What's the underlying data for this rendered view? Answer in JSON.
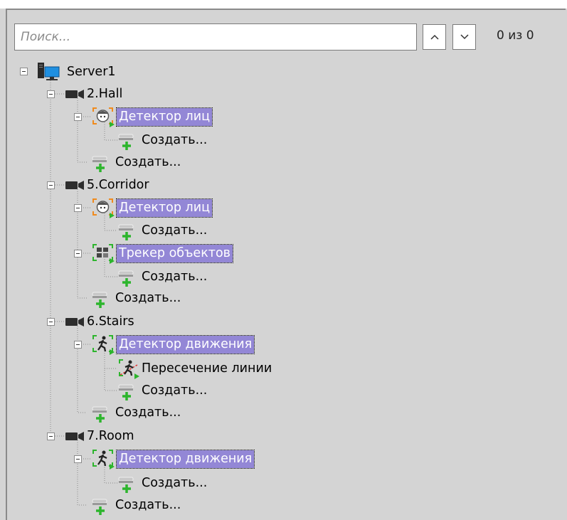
{
  "search": {
    "placeholder": "Поиск...",
    "value": ""
  },
  "nav": {
    "up_glyph": "^",
    "down_glyph": "⌄",
    "counter": "0 из 0"
  },
  "tree": {
    "server": {
      "label": "Server1",
      "icon": "server-icon"
    },
    "cameras": [
      {
        "label": "2.Hall",
        "detectors": [
          {
            "label": "Детектор лиц",
            "icon": "face-detector-icon",
            "selected": true,
            "children": [
              {
                "label": "Создать...",
                "icon": "create-icon"
              }
            ]
          }
        ],
        "create": "Создать..."
      },
      {
        "label": "5.Corridor",
        "detectors": [
          {
            "label": "Детектор лиц",
            "icon": "face-detector-icon",
            "selected": true,
            "children": [
              {
                "label": "Создать...",
                "icon": "create-icon"
              }
            ]
          },
          {
            "label": "Трекер объектов",
            "icon": "object-tracker-icon",
            "selected": true,
            "children": [
              {
                "label": "Создать...",
                "icon": "create-icon"
              }
            ]
          }
        ],
        "create": "Создать..."
      },
      {
        "label": "6.Stairs",
        "detectors": [
          {
            "label": "Детектор движения",
            "icon": "motion-detector-icon",
            "selected": true,
            "children": [
              {
                "label": "Пересечение линии",
                "icon": "line-crossing-icon"
              },
              {
                "label": "Создать...",
                "icon": "create-icon"
              }
            ]
          }
        ],
        "create": "Создать..."
      },
      {
        "label": "7.Room",
        "detectors": [
          {
            "label": "Детектор движения",
            "icon": "motion-detector-icon",
            "selected": true,
            "children": [
              {
                "label": "Создать...",
                "icon": "create-icon"
              }
            ]
          }
        ],
        "create": "Создать..."
      }
    ]
  },
  "colors": {
    "selection": "#9387d6",
    "background": "#d4d4d4",
    "create_plus": "#2db52d",
    "face_bracket": "#f08a1c"
  }
}
